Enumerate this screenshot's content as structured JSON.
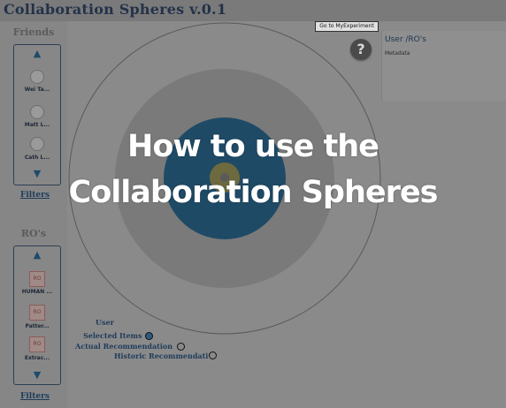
{
  "app": {
    "title": "Collaboration Spheres v.0.1"
  },
  "sidebar": {
    "friends": {
      "title": "Friends",
      "items": [
        {
          "label": "Wei Ta..."
        },
        {
          "label": "Matt L..."
        },
        {
          "label": "Cath L..."
        }
      ],
      "filters": "Filters"
    },
    "ros": {
      "title": "RO's",
      "items": [
        {
          "label": "HUMAN ...",
          "icon_text": "RO"
        },
        {
          "label": "Patter...",
          "icon_text": "RO"
        },
        {
          "label": "Extrac...",
          "icon_text": "RO"
        }
      ],
      "filters": "Filters"
    }
  },
  "toolbar": {
    "my_experiment": "Go to MyExperiment",
    "help": "?"
  },
  "info_panel": {
    "title": "User /RO's",
    "metadata": "Metadata"
  },
  "legend": {
    "user": "User",
    "selected": "Selected Items",
    "actual": "Actual Recommendation",
    "historic": "Historic Recommendati"
  },
  "overlay": {
    "line1": "How to use the",
    "line2": "Collaboration Spheres"
  },
  "colors": {
    "inner_sphere": "#1f4a66",
    "center": "#6e6a3f",
    "selected_dot": "#2c5d7a",
    "outer_ring_fill": "#7a7a7a"
  }
}
